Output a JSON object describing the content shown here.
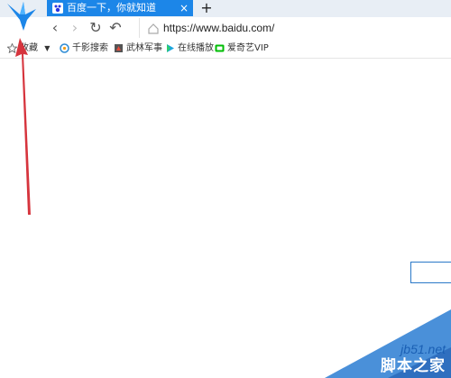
{
  "tabs": [
    {
      "title": "百度一下，你就知道",
      "close": "×"
    }
  ],
  "new_tab": "+",
  "navigation": {
    "back": "‹",
    "forward": "›",
    "reload": "↻",
    "undo": "↶",
    "url": "https://www.baidu.com/"
  },
  "bookmarks": {
    "favorites_label": "收藏",
    "items": [
      {
        "label": "千影搜索",
        "icon": "search-icon"
      },
      {
        "label": "武林军事",
        "icon": "military-icon"
      },
      {
        "label": "在线播放",
        "icon": "play-icon"
      },
      {
        "label": "爱奇艺VIP",
        "icon": "iqiyi-icon"
      }
    ]
  },
  "watermark": {
    "site": "jb51.net",
    "name": "脚本之家"
  },
  "colors": {
    "tab_active": "#1c86e8",
    "arrow": "#d6343d",
    "logo": "#1c86e8"
  }
}
